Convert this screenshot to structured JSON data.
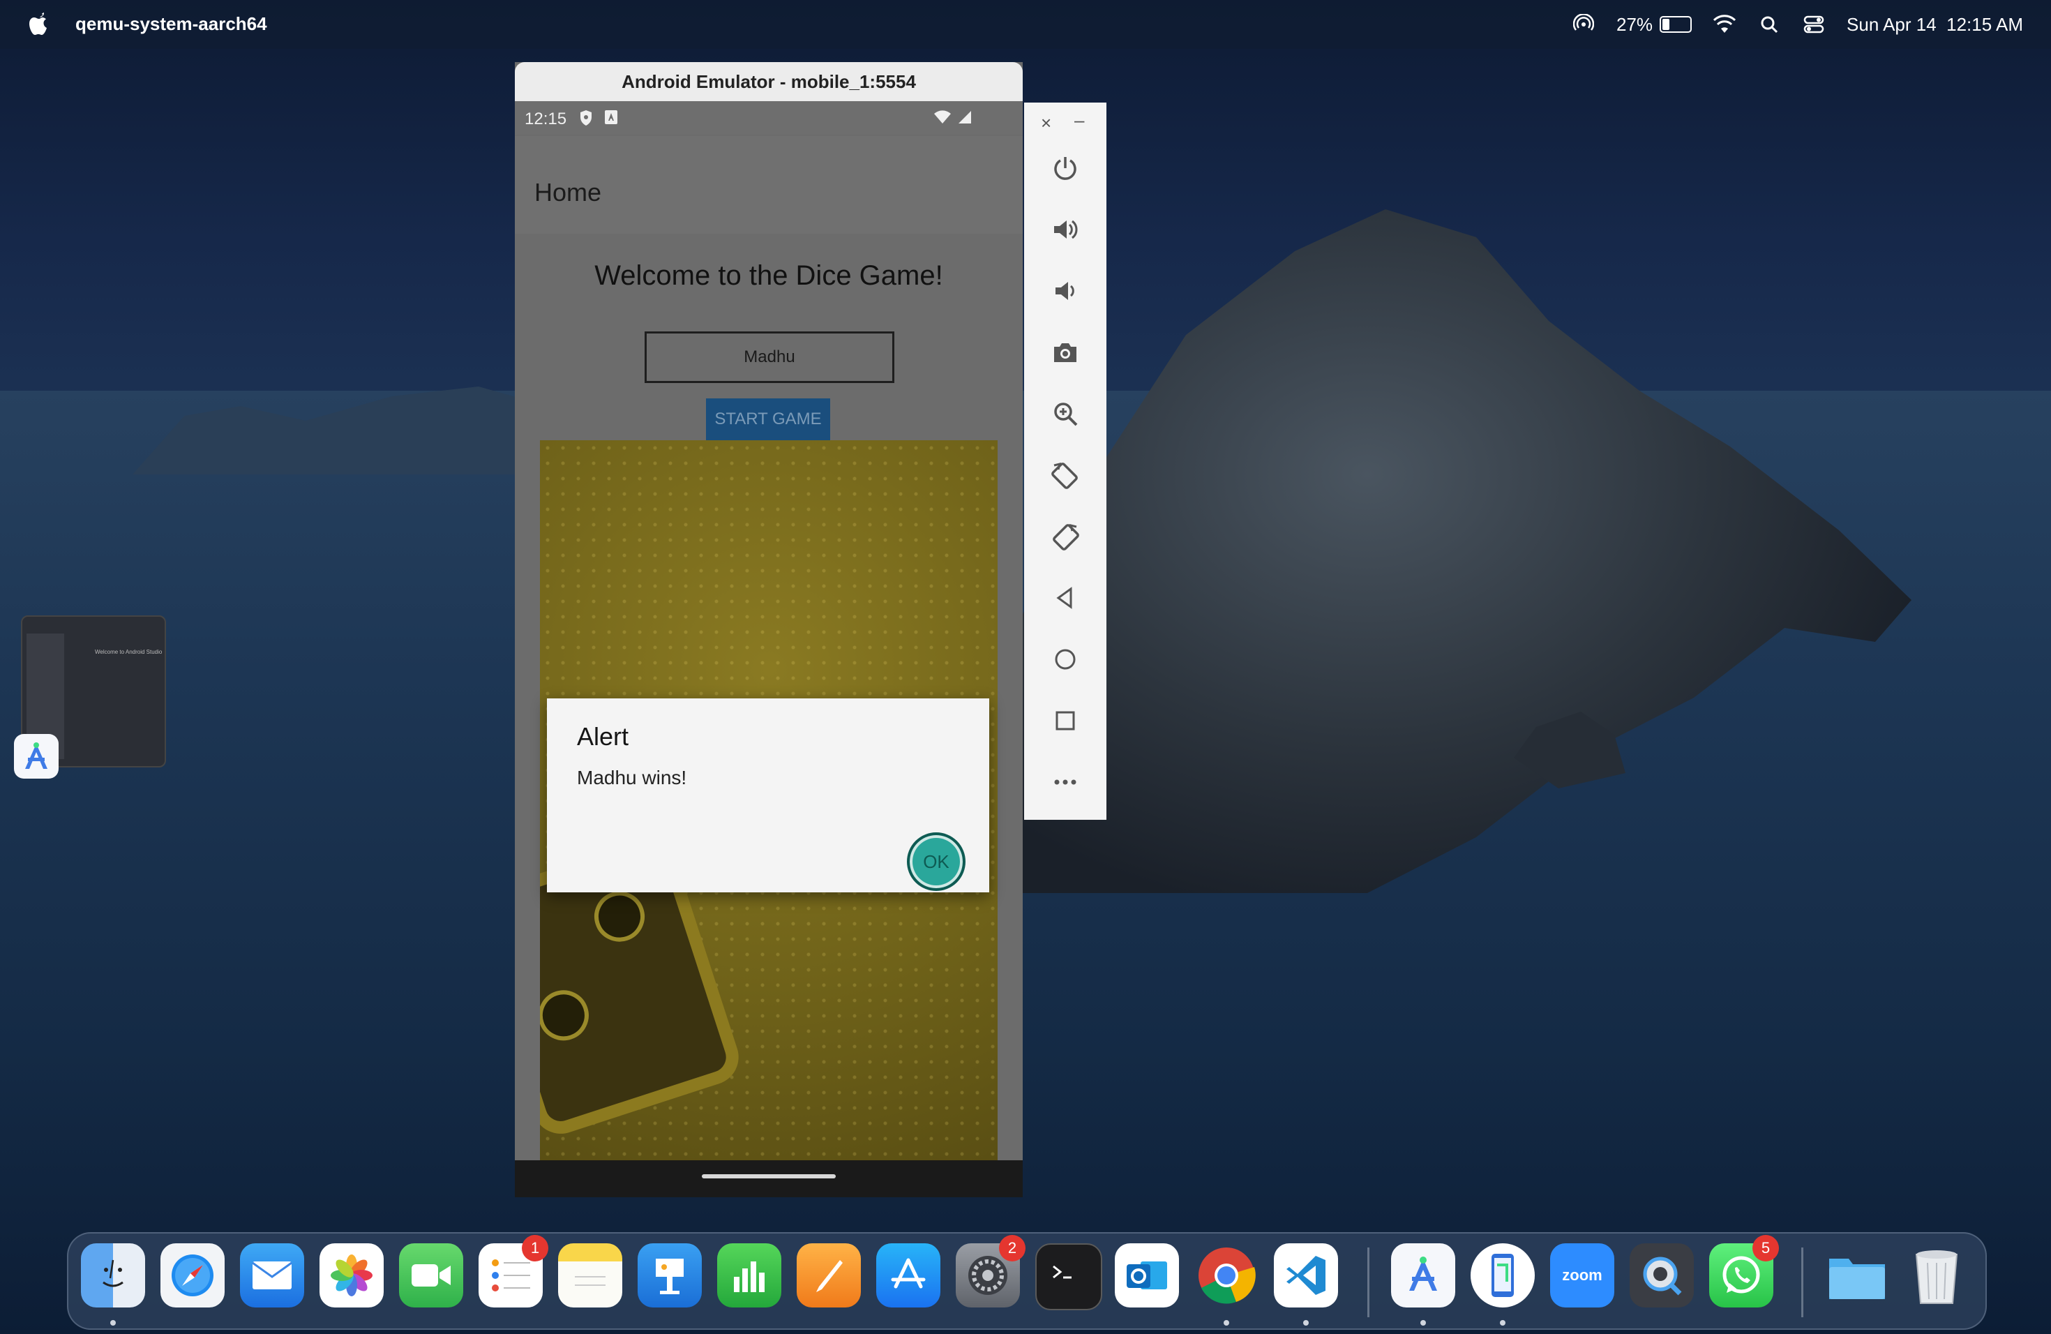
{
  "menubar": {
    "app_name": "qemu-system-aarch64",
    "battery_percent": "27%",
    "battery_level": 0.27,
    "datetime": "Sun Apr 14  12:15 AM"
  },
  "emulator": {
    "window_title": "Android Emulator - mobile_1:5554",
    "status_time": "12:15",
    "appbar_title": "Home",
    "welcome_text": "Welcome to the Dice Game!",
    "name_value": "Madhu",
    "start_button": "START GAME",
    "alert": {
      "title": "Alert",
      "message": "Madhu wins!",
      "ok_label": "OK"
    }
  },
  "toolbar": {
    "close": "×",
    "minimize": "–",
    "buttons": [
      "power-icon",
      "volume-up-icon",
      "volume-down-icon",
      "camera-icon",
      "zoom-icon",
      "rotate-left-icon",
      "rotate-right-icon",
      "back-icon",
      "home-icon",
      "overview-icon",
      "more-icon"
    ]
  },
  "mini_window": {
    "text": "Welcome to Android Studio"
  },
  "dock": {
    "items": [
      {
        "name": "finder",
        "badge": ""
      },
      {
        "name": "safari",
        "badge": ""
      },
      {
        "name": "mail",
        "badge": ""
      },
      {
        "name": "photos",
        "badge": ""
      },
      {
        "name": "facetime",
        "badge": ""
      },
      {
        "name": "reminders",
        "badge": "1"
      },
      {
        "name": "notes",
        "badge": ""
      },
      {
        "name": "keynote",
        "badge": ""
      },
      {
        "name": "numbers",
        "badge": ""
      },
      {
        "name": "pages",
        "badge": ""
      },
      {
        "name": "app-store",
        "badge": ""
      },
      {
        "name": "system-settings",
        "badge": "2"
      },
      {
        "name": "terminal",
        "badge": ""
      },
      {
        "name": "outlook",
        "badge": ""
      },
      {
        "name": "chrome",
        "badge": ""
      },
      {
        "name": "vscode",
        "badge": ""
      },
      {
        "name": "android-studio",
        "badge": ""
      },
      {
        "name": "emulator",
        "badge": ""
      },
      {
        "name": "zoom",
        "badge": ""
      },
      {
        "name": "quicktime",
        "badge": ""
      },
      {
        "name": "whatsapp",
        "badge": "5"
      },
      {
        "name": "folder",
        "badge": ""
      },
      {
        "name": "trash",
        "badge": ""
      }
    ],
    "zoom_label": "zoom"
  }
}
